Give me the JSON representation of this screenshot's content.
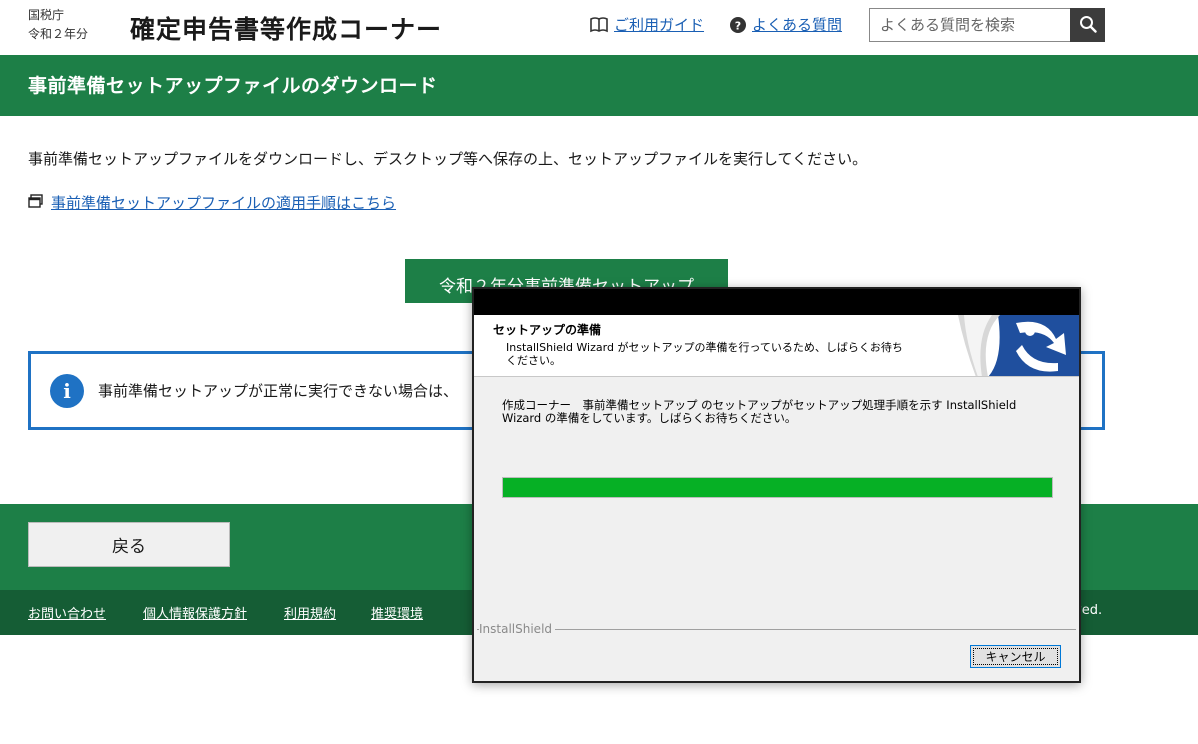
{
  "header": {
    "agency": "国税庁",
    "year": "令和２年分",
    "site_title": "確定申告書等作成コーナー",
    "guide_link": "ご利用ガイド",
    "faq_link": "よくある質問",
    "search_placeholder": "よくある質問を検索"
  },
  "page": {
    "title": "事前準備セットアップファイルのダウンロード",
    "lead": "事前準備セットアップファイルをダウンロードし、デスクトップ等へ保存の上、セットアップファイルを実行してください。",
    "procedure_link": "事前準備セットアップファイルの適用手順はこちら",
    "download_button": "令和２年分事前準備セットアップ",
    "notice_text": "事前準備セットアップが正常に実行できない場合は、"
  },
  "footer": {
    "back_button": "戻る",
    "links": [
      "お問い合わせ",
      "個人情報保護方針",
      "利用規約",
      "推奨環境"
    ],
    "copyright_fragment": "ved."
  },
  "dialog": {
    "heading": "セットアップの準備",
    "subheading": "InstallShield Wizard がセットアップの準備を行っているため、しばらくお待ちください。",
    "body": "作成コーナー　事前準備セットアップ のセットアップがセットアップ処理手順を示す InstallShield Wizard の準備をしています。しばらくお待ちください。",
    "progress": 1.0,
    "brand": "InstallShield",
    "cancel_button": "キャンセル"
  },
  "colors": {
    "brand_green": "#1d7f47",
    "footer_dark_green": "#155d35",
    "link_blue": "#1a5fb4",
    "notice_blue": "#1f72c4",
    "progress_green": "#06b025"
  },
  "icons": [
    "book-icon",
    "question-icon",
    "search-icon",
    "window-icon",
    "info-icon",
    "installshield-logo"
  ]
}
